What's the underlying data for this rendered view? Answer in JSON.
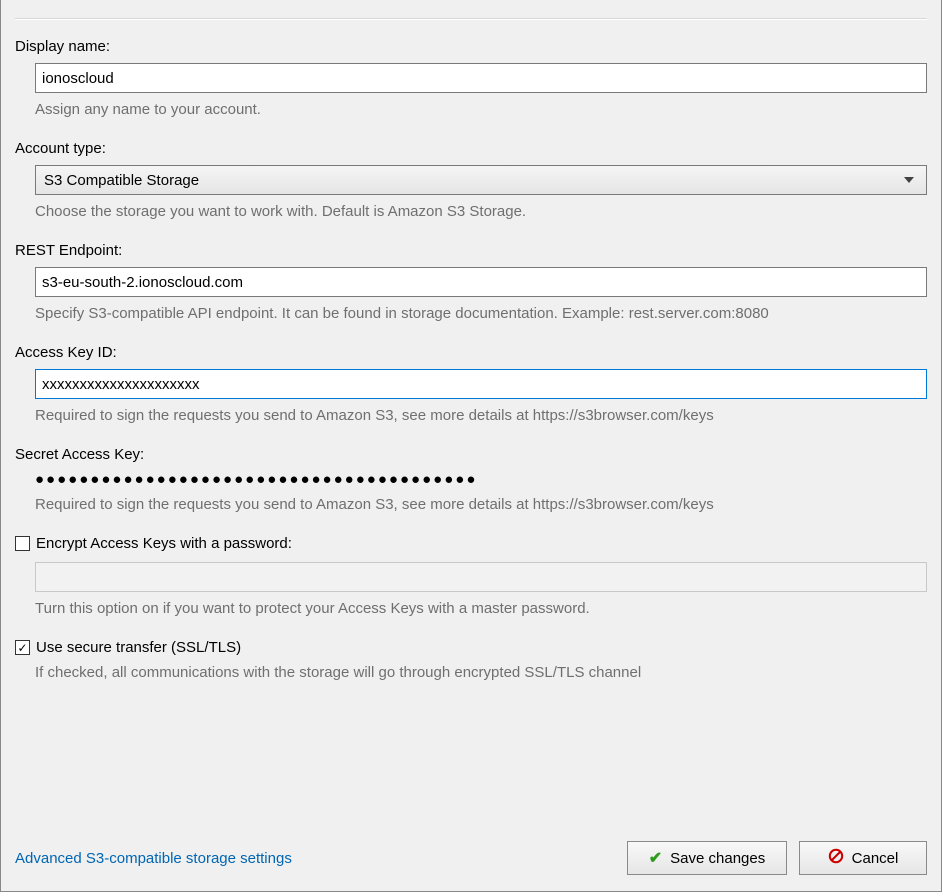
{
  "display_name": {
    "label": "Display name:",
    "value": "ionoscloud",
    "help": "Assign any name to your account."
  },
  "account_type": {
    "label": "Account type:",
    "selected": "S3 Compatible Storage",
    "help": "Choose the storage you want to work with. Default is Amazon S3 Storage."
  },
  "rest_endpoint": {
    "label": "REST Endpoint:",
    "value": "s3-eu-south-2.ionoscloud.com",
    "help": "Specify S3-compatible API endpoint. It can be found in storage documentation. Example: rest.server.com:8080"
  },
  "access_key": {
    "label": "Access Key ID:",
    "value": "xxxxxxxxxxxxxxxxxxxxx",
    "help": "Required to sign the requests you send to Amazon S3, see more details at https://s3browser.com/keys"
  },
  "secret_key": {
    "label": "Secret Access Key:",
    "masked_value": "●●●●●●●●●●●●●●●●●●●●●●●●●●●●●●●●●●●●●●●●",
    "help": "Required to sign the requests you send to Amazon S3, see more details at https://s3browser.com/keys"
  },
  "encrypt": {
    "label": "Encrypt Access Keys with a password:",
    "checked": false,
    "help": "Turn this option on if you want to protect your Access Keys with a master password."
  },
  "ssl": {
    "label": "Use secure transfer (SSL/TLS)",
    "checked": true,
    "check_glyph": "✓",
    "help": "If checked, all communications with the storage will go through encrypted SSL/TLS channel"
  },
  "footer": {
    "advanced_link": "Advanced S3-compatible storage settings",
    "save_label": "Save changes",
    "cancel_label": "Cancel"
  }
}
